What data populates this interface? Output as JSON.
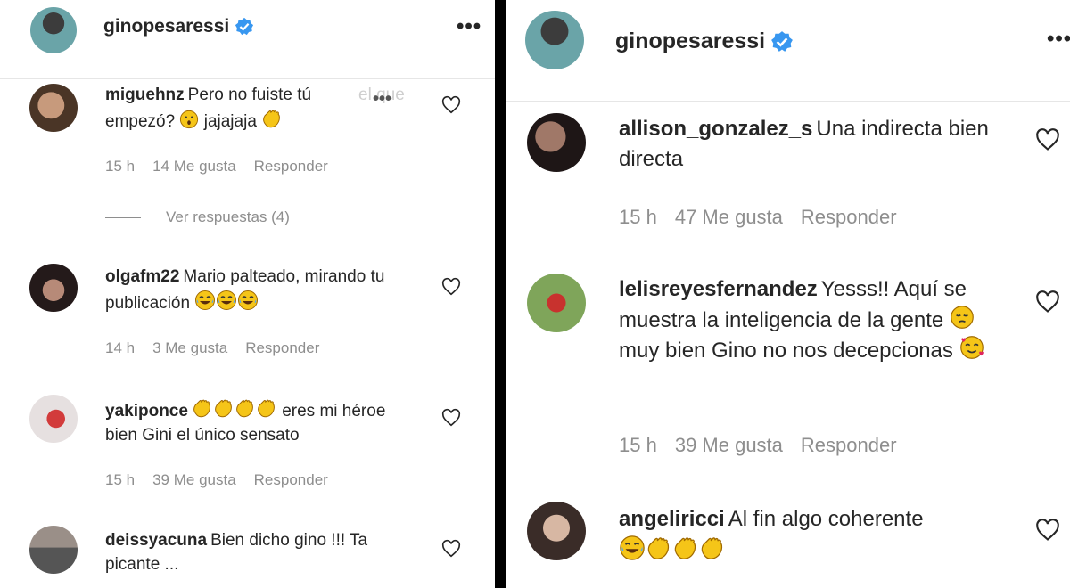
{
  "left": {
    "header": {
      "username": "ginopesaressi"
    },
    "ghost_text": "el que",
    "view_replies": "Ver respuestas (4)",
    "comments": [
      {
        "user": "miguehnz",
        "text": "Pero no fuiste tú",
        "text2": "empezó?",
        "text3": "jajajaja",
        "time": "15 h",
        "likes": "14 Me gusta",
        "reply": "Responder"
      },
      {
        "user": "olgafm22",
        "text": "Mario palteado, mirando tu publicación",
        "time": "14 h",
        "likes": "3 Me gusta",
        "reply": "Responder"
      },
      {
        "user": "yakiponce",
        "text": "eres mi héroe bien Gini el único sensato",
        "time": "15 h",
        "likes": "39 Me gusta",
        "reply": "Responder"
      },
      {
        "user": "deissyacuna",
        "text": "Bien dicho gino !!! Ta picante ...",
        "time": "",
        "likes": "",
        "reply": ""
      }
    ]
  },
  "right": {
    "header": {
      "username": "ginopesaressi"
    },
    "comments": [
      {
        "user": "allison_gonzalez_s",
        "text": "Una indirecta bien directa",
        "time": "15 h",
        "likes": "47 Me gusta",
        "reply": "Responder"
      },
      {
        "user": "lelisreyesfernandez",
        "text": "Yesss!! Aquí se muestra la inteligencia de la gente",
        "text2": "muy bien Gino no nos decepcionas",
        "time": "15 h",
        "likes": "39 Me gusta",
        "reply": "Responder"
      },
      {
        "user": "angeliricci",
        "text": "Al fin algo coherente",
        "time": "",
        "likes": "",
        "reply": ""
      }
    ]
  },
  "colors": {
    "verified": "#3897f0",
    "emoji": "#f5c518",
    "muted": "#8e8e8e"
  },
  "icons": [
    "verified-badge-icon",
    "more-options-icon",
    "heart-icon",
    "clapping-hands-emoji",
    "hushed-face-emoji",
    "crying-laughing-emoji",
    "pensive-face-emoji",
    "smiling-hearts-face-emoji"
  ]
}
